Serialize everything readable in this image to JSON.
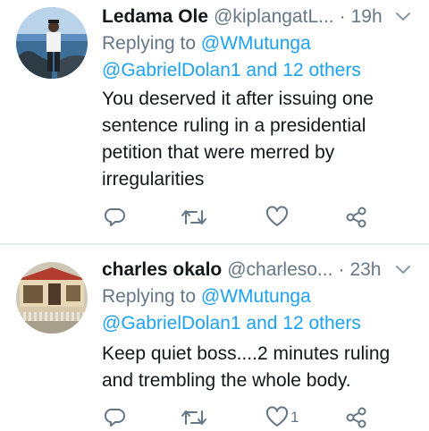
{
  "tweets": [
    {
      "name": "Ledama Ole",
      "handle": "@kiplangatL...",
      "separator": "·",
      "time": "19h",
      "replying_prefix": "Replying to",
      "replying_user": "@WMutunga",
      "replying_line2": "@GabrielDolan1 and 12 others",
      "body_lines": [
        "You deserved it after issuing one",
        "sentence ruling in a presidential",
        "petition that were merred by",
        "irregularities"
      ],
      "like_count": "",
      "icons": {
        "reply": "reply-icon",
        "retweet": "retweet-icon",
        "like": "heart-icon",
        "share": "share-icon",
        "menu": "chevron-down-icon"
      }
    },
    {
      "name": "charles okalo",
      "handle": "@charleso...",
      "separator": "·",
      "time": "23h",
      "replying_prefix": "Replying to",
      "replying_user": "@WMutunga",
      "replying_line2": "@GabrielDolan1 and 12 others",
      "body_lines": [
        "Keep quiet boss....2 minutes ruling",
        "and trembling the whole body."
      ],
      "like_count": "1",
      "icons": {
        "reply": "reply-icon",
        "retweet": "retweet-icon",
        "like": "heart-icon",
        "share": "share-icon",
        "menu": "chevron-down-icon"
      }
    }
  ],
  "colors": {
    "link": "#1da1f2",
    "muted": "#657786",
    "text": "#14171a",
    "divider": "#e6ecf0"
  }
}
